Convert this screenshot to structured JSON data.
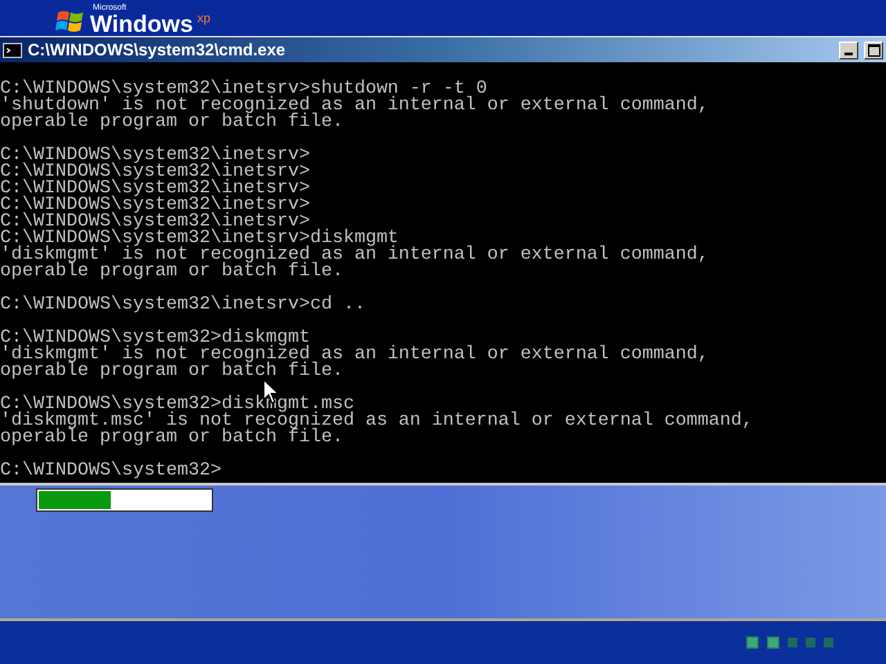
{
  "boot_screen": {
    "logo": {
      "small": "Microsoft",
      "name": "Windows",
      "suffix": "xp"
    },
    "progress": {
      "level": 0.42
    },
    "loading_dots": [
      {
        "lit": true
      },
      {
        "lit": true
      },
      {
        "lit": false
      },
      {
        "lit": false
      },
      {
        "lit": false
      }
    ]
  },
  "window": {
    "title": "C:\\WINDOWS\\system32\\cmd.exe",
    "buttons": [
      {
        "kind": "minimize"
      },
      {
        "kind": "maximize"
      }
    ]
  },
  "console": {
    "blocks": [
      [
        "C:\\WINDOWS\\system32\\inetsrv>shutdown -r -t 0",
        "'shutdown' is not recognized as an internal or external command,",
        "operable program or batch file."
      ],
      [
        "C:\\WINDOWS\\system32\\inetsrv>",
        "C:\\WINDOWS\\system32\\inetsrv>",
        "C:\\WINDOWS\\system32\\inetsrv>",
        "C:\\WINDOWS\\system32\\inetsrv>",
        "C:\\WINDOWS\\system32\\inetsrv>",
        "C:\\WINDOWS\\system32\\inetsrv>diskmgmt",
        "'diskmgmt' is not recognized as an internal or external command,",
        "operable program or batch file."
      ],
      [
        "C:\\WINDOWS\\system32\\inetsrv>cd .."
      ],
      [
        "C:\\WINDOWS\\system32>diskmgmt",
        "'diskmgmt' is not recognized as an internal or external command,",
        "operable program or batch file."
      ],
      [
        "C:\\WINDOWS\\system32>diskmgmt.msc",
        "'diskmgmt.msc' is not recognized as an internal or external command,",
        "operable program or batch file."
      ],
      [
        "C:\\WINDOWS\\system32>"
      ]
    ]
  }
}
